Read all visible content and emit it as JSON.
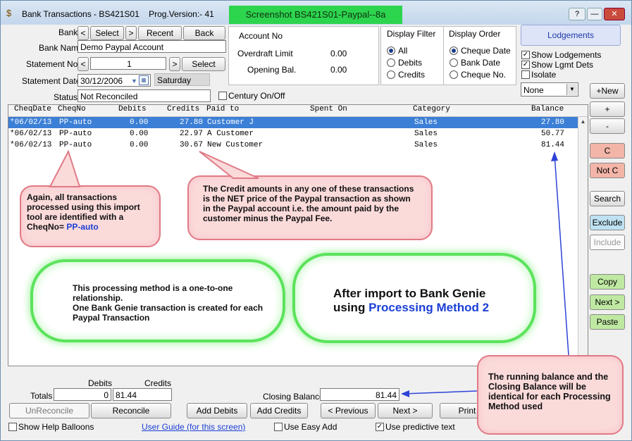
{
  "window": {
    "title": "Bank Transactions - BS421S01",
    "prog_version": "Prog.Version:- 41",
    "banner": "Screenshot BS421S01-Paypal--8a",
    "help_label": "?"
  },
  "bank_nav": {
    "bank_label": "Bank",
    "prev_arrow": "<",
    "select": "Select",
    "next_arrow": ">",
    "recent": "Recent",
    "back": "Back"
  },
  "fields": {
    "bank_name_label": "Bank Name",
    "bank_name_value": "Demo Paypal Account",
    "statement_no_label": "Statement No.",
    "statement_no_value": "1",
    "statement_select": "Select",
    "statement_date_label": "Statement Date",
    "statement_date_value": "30/12/2006",
    "statement_day": "Saturday",
    "status_label": "Status",
    "status_value": "Not Reconciled",
    "century_label": "Century On/Off"
  },
  "account_info": {
    "account_no_label": "Account No",
    "overdraft_label": "Overdraft Limit",
    "overdraft_value": "0.00",
    "opening_label": "Opening Bal.",
    "opening_value": "0.00"
  },
  "display_filter": {
    "title": "Display Filter",
    "options": [
      "All",
      "Debits",
      "Credits"
    ],
    "selected": "All"
  },
  "display_order": {
    "title": "Display Order",
    "options": [
      "Cheque Date",
      "Bank Date",
      "Cheque No."
    ],
    "selected": "Cheque Date"
  },
  "lodgements": {
    "button": "Lodgements",
    "show_lodgements": "Show Lodgements",
    "show_lgmt_dets": "Show Lgmt Dets",
    "isolate": "Isolate",
    "dropdown_value": "None"
  },
  "grid": {
    "headers": [
      "CheqDate",
      "CheqNo",
      "Debits",
      "Credits",
      "Paid to",
      "Spent On",
      "Category",
      "Balance"
    ],
    "rows": [
      {
        "date": "*06/02/13",
        "cheq": "PP-auto",
        "debits": "0.00",
        "credits": "27.80",
        "paid_to": "Customer J",
        "spent_on": "",
        "category": "Sales",
        "balance": "27.80"
      },
      {
        "date": "*06/02/13",
        "cheq": "PP-auto",
        "debits": "0.00",
        "credits": "22.97",
        "paid_to": "A Customer",
        "spent_on": "",
        "category": "Sales",
        "balance": "50.77"
      },
      {
        "date": "*06/02/13",
        "cheq": "PP-auto",
        "debits": "0.00",
        "credits": "30.67",
        "paid_to": "New Customer",
        "spent_on": "",
        "category": "Sales",
        "balance": "81.44"
      }
    ]
  },
  "right_buttons": {
    "new": "+New",
    "plus": "+",
    "minus": "-",
    "c": "C",
    "not_c": "Not C",
    "search": "Search",
    "exclude": "Exclude",
    "include": "Include",
    "copy": "Copy",
    "next": "Next >",
    "paste": "Paste"
  },
  "callouts": {
    "ppauto_text": "Again, all transactions processed using this import tool are identified with a CheqNo=",
    "ppauto_highlight": "PP-auto",
    "credit_text": "The Credit amounts in any one of these transactions is the NET price of the Paypal transaction as shown in the Paypal account i.e. the amount paid by the customer minus the Paypal Fee.",
    "one_to_one_text": "This processing method is a one-to-one relationship.\nOne Bank Genie transaction is created for each Paypal Transaction",
    "method_text": "After import to Bank Genie using",
    "method_highlight": "Processing Method 2",
    "balance_text": "The running balance and the Closing Balance will be identical for each Processing Method used"
  },
  "totals": {
    "debits_label": "Debits",
    "credits_label": "Credits",
    "totals_label": "Totals",
    "debits_value": "0",
    "credits_value": "81.44",
    "closing_label": "Closing Balance",
    "closing_value": "81.44"
  },
  "bottom_buttons": {
    "unreconcile": "UnReconcile",
    "reconcile": "Reconcile",
    "add_debits": "Add Debits",
    "add_credits": "Add Credits",
    "previous": "< Previous",
    "next": "Next >",
    "print": "Print"
  },
  "footer": {
    "show_help": "Show Help Balloons",
    "user_guide": "User Guide (for this screen)",
    "easy_add": "Use Easy Add",
    "predictive": "Use predictive text"
  },
  "colors": {
    "accent": "#3c7fd6",
    "callout_fill": "#fbdada",
    "cloud_border": "#5be35b",
    "highlight_text": "#1b3fd6"
  }
}
